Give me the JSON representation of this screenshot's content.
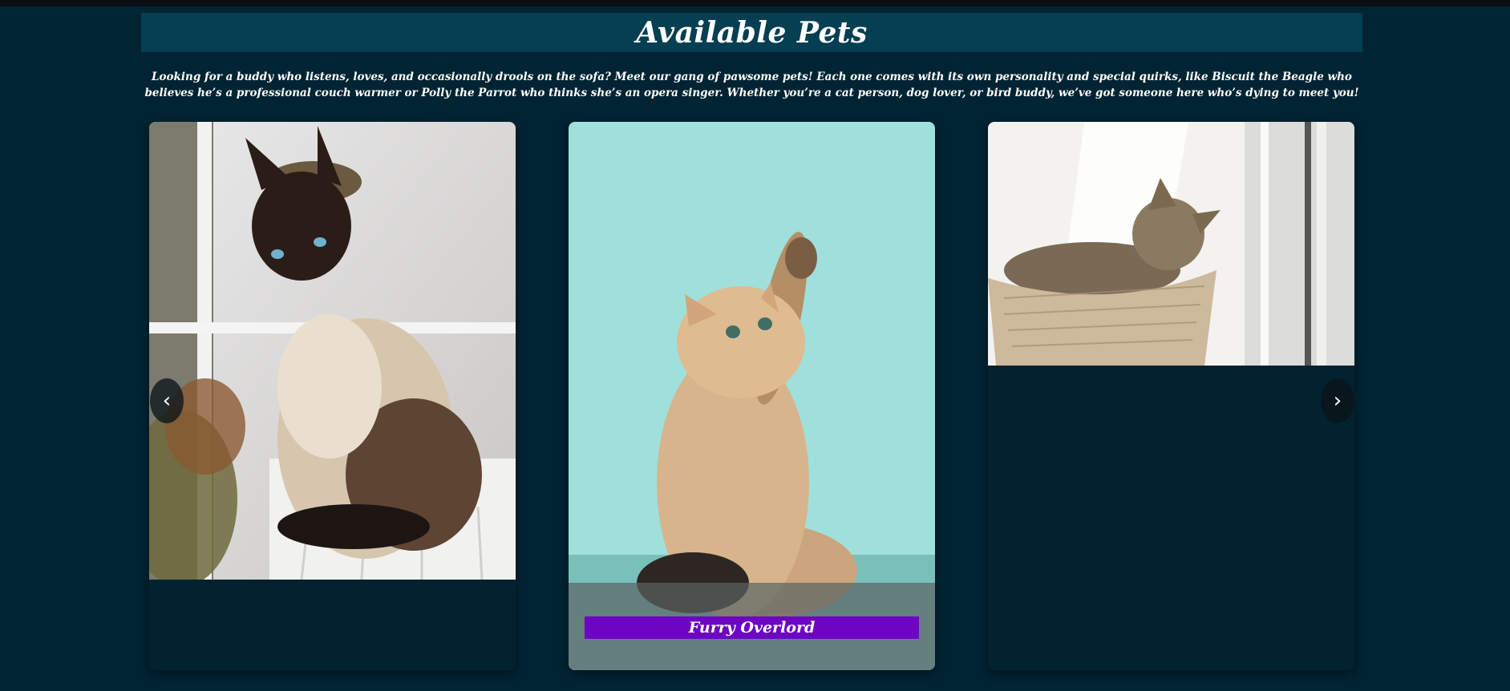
{
  "page": {
    "title": "Available Pets",
    "intro": "Looking for a buddy who listens, loves, and occasionally drools on the sofa? Meet our gang of pawsome pets! Each one comes with its own personality and special quirks, like Biscuit the Beagle who believes he’s a professional couch warmer or Polly the Parrot who thinks she’s an opera singer. Whether you’re a cat person, dog lover, or bird buddy, we’ve got someone here who’s dying to meet you!"
  },
  "carousel": {
    "prev_label": "‹",
    "next_label": "›",
    "cards": [
      {
        "photo": "siamese-cat-photo",
        "name": ""
      },
      {
        "photo": "kitten-reaching-photo",
        "name": "Furry Overlord"
      },
      {
        "photo": "tabby-cat-basket-photo",
        "name": ""
      }
    ]
  },
  "colors": {
    "background": "#012433",
    "header": "#053f51",
    "name_tag": "#6d05c3",
    "card": "#03222f"
  }
}
